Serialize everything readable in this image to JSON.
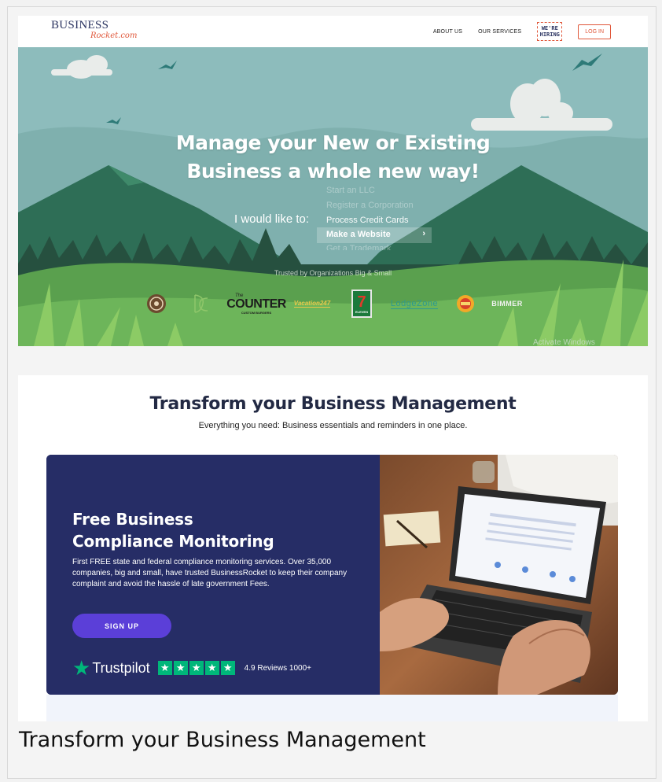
{
  "header": {
    "logo_top": "BUSINESS",
    "logo_bottom": "Rocket.com",
    "nav": [
      "ABOUT US",
      "OUR SERVICES"
    ],
    "hiring_line1": "WE'RE",
    "hiring_line2": "HIRING",
    "login_label": "LOG IN"
  },
  "hero": {
    "title_line1": "Manage your New or Existing",
    "title_line2": "Business a whole new way!",
    "prompt": "I would like to:",
    "options": [
      "Start an LLC",
      "Register a Corporation",
      "Process Credit Cards",
      "Make a Website",
      "Get a Trademark"
    ],
    "selected_option": "Make a Website",
    "trusted_text": "Trusted by Organizations Big & Small",
    "brands": [
      "COUNTER",
      "Vacation247",
      "7",
      "LodgeZone",
      "BIMMER"
    ],
    "brand_counter_sub": "The",
    "brand_counter_tag": "CUSTOM BURGERS",
    "brand_eleven": "ELEVEN",
    "watermark": "Activate Windows"
  },
  "section": {
    "title": "Transform your Business Management",
    "subtitle": "Everything you need: Business essentials and reminders in one place.",
    "card": {
      "title_line1": "Free Business",
      "title_line2": "Compliance Monitoring",
      "text": "First FREE state and federal compliance monitoring services. Over 35,000 companies, big and small, have trusted BusinessRocket to keep their company complaint and avoid the hassle of late government Fees.",
      "button": "SIGN UP",
      "trustpilot": "Trustpilot",
      "reviews": "4.9 Reviews 1000+"
    }
  },
  "caption": "Transform your Business Management",
  "colors": {
    "navy": "#262d66",
    "accent": "#e0573a",
    "signup": "#5b3fd8",
    "trustpilot": "#00b67a",
    "sky": "#8dbcbc"
  }
}
